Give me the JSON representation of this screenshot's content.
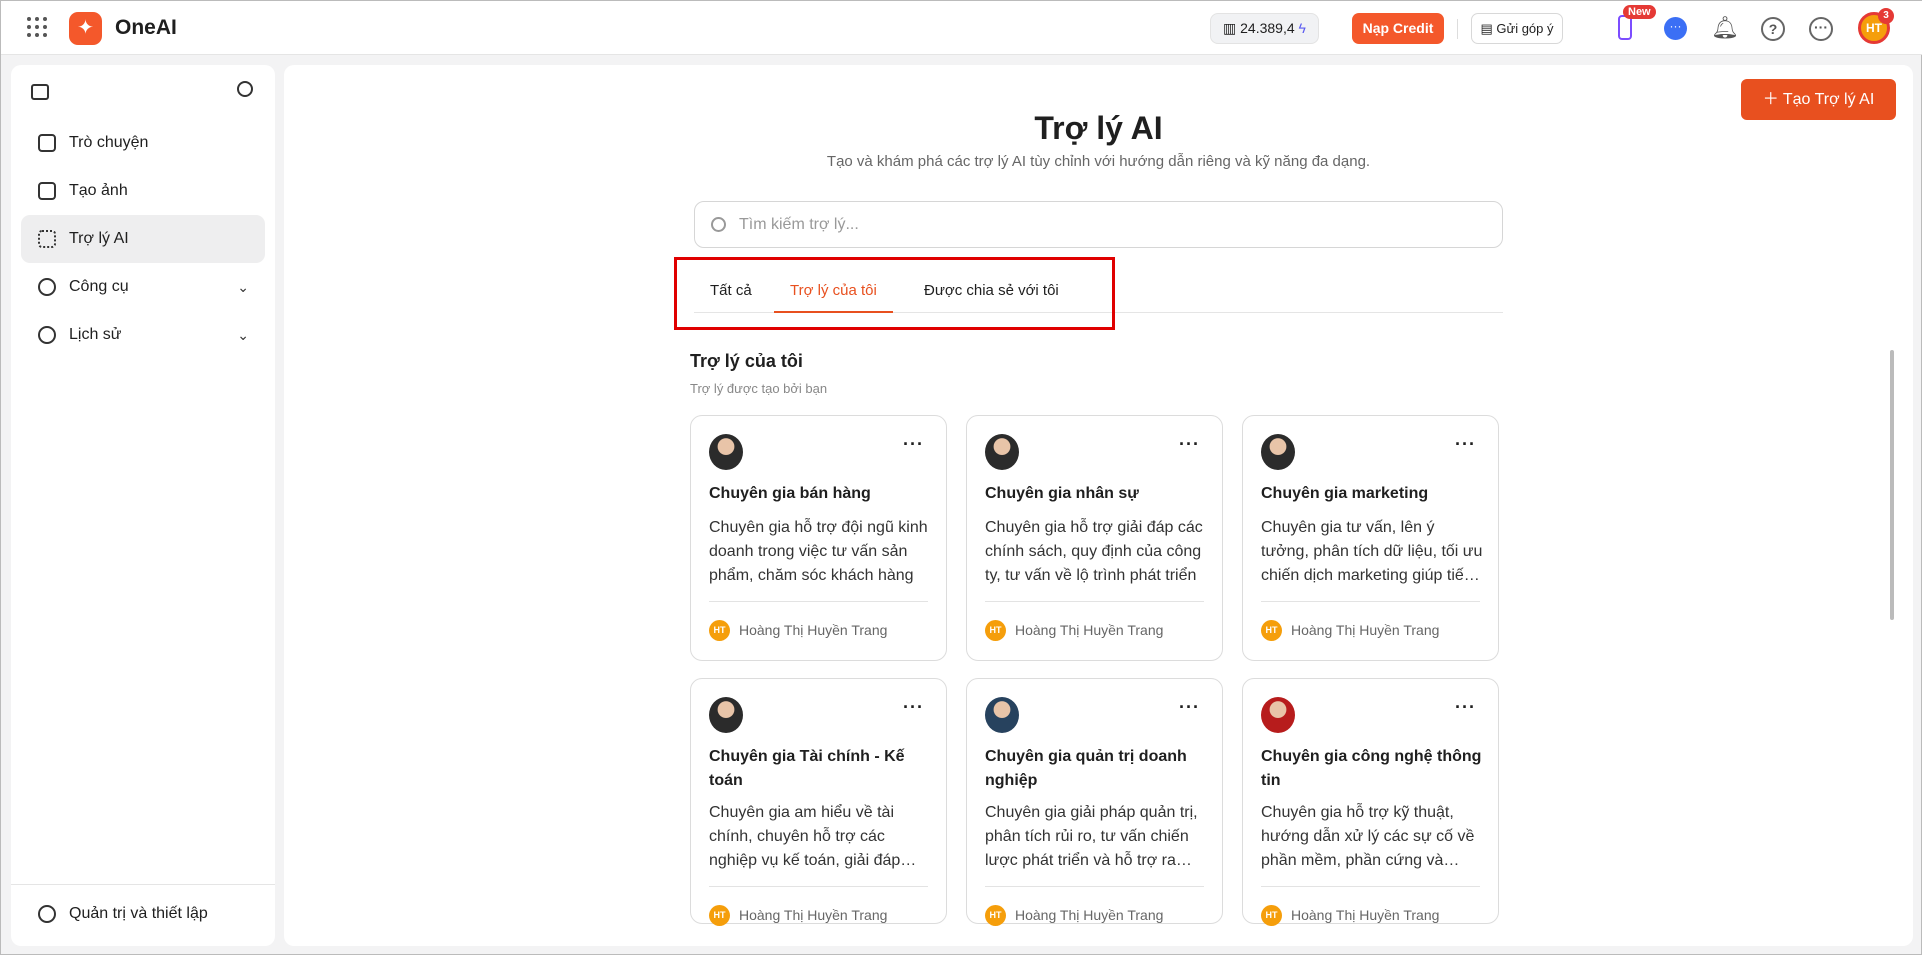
{
  "header": {
    "brand": "OneAI",
    "credit": "24.389,4",
    "topup": "Nạp Credit",
    "feedback": "Gửi góp ý",
    "new_badge": "New",
    "avatar": "HT",
    "notif_count": "3"
  },
  "sidebar": {
    "items": [
      {
        "label": "Trò chuyện"
      },
      {
        "label": "Tạo ảnh"
      },
      {
        "label": "Trợ lý AI"
      },
      {
        "label": "Công cụ"
      },
      {
        "label": "Lịch sử"
      }
    ],
    "settings": "Quản trị và thiết lập"
  },
  "main": {
    "create": "Tạo Trợ lý AI",
    "title": "Trợ lý AI",
    "subtitle": "Tạo và khám phá các trợ lý AI tùy chỉnh với hướng dẫn riêng và kỹ năng đa dạng.",
    "search_placeholder": "Tìm kiếm trợ lý...",
    "tabs": [
      "Tất cả",
      "Trợ lý của tôi",
      "Được chia sẻ với tôi"
    ],
    "section_title": "Trợ lý của tôi",
    "section_sub": "Trợ lý được tạo bởi bạn",
    "cards": [
      {
        "title": "Chuyên gia bán hàng",
        "desc": "Chuyên gia hỗ trợ đội ngũ kinh doanh trong việc tư vấn sản phẩm, chăm sóc khách hàng",
        "author": "Hoàng Thị Huyền Trang",
        "initials": "HT"
      },
      {
        "title": "Chuyên gia nhân sự",
        "desc": "Chuyên gia hỗ trợ giải đáp các chính sách, quy định của công ty, tư vấn về lộ trình phát triển",
        "author": "Hoàng Thị Huyền Trang",
        "initials": "HT"
      },
      {
        "title": "Chuyên gia marketing",
        "desc": "Chuyên gia tư vấn, lên ý tưởng, phân tích dữ liệu, tối ưu chiến dịch marketing giúp tiếp cận",
        "author": "Hoàng Thị Huyền Trang",
        "initials": "HT"
      },
      {
        "title": "Chuyên gia Tài chính - Kế toán",
        "desc": "Chuyên gia am hiểu về tài chính, chuyên hỗ trợ các nghiệp vụ kế toán, giải đáp thắc mắc",
        "author": "Hoàng Thị Huyền Trang",
        "initials": "HT"
      },
      {
        "title": "Chuyên gia quản trị doanh nghiệp",
        "desc": "Chuyên gia giải pháp quản trị, phân tích rủi ro, tư vấn chiến lược phát triển và hỗ trợ ra quyết định",
        "author": "Hoàng Thị Huyền Trang",
        "initials": "HT"
      },
      {
        "title": "Chuyên gia công nghệ thông tin",
        "desc": "Chuyên gia hỗ trợ kỹ thuật, hướng dẫn xử lý các sự cố về phần mềm, phần cứng và mạng",
        "author": "Hoàng Thị Huyền Trang",
        "initials": "HT"
      }
    ]
  },
  "colors": {
    "accent": "#e8501f",
    "brand": "#f4582b"
  }
}
